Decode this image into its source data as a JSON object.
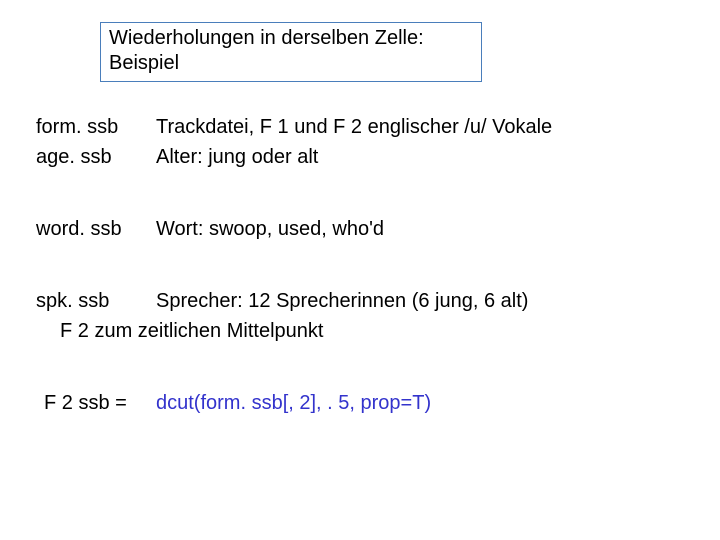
{
  "title": "Wiederholungen in derselben Zelle: Beispiel",
  "rows": [
    {
      "term": "form. ssb",
      "desc": "Trackdatei, F 1 und F 2 englischer /u/ Vokale"
    },
    {
      "term": "age. ssb",
      "desc": "Alter: jung oder alt"
    },
    {
      "term": "word. ssb",
      "desc": "Wort: swoop, used, who'd"
    },
    {
      "term": "spk. ssb",
      "desc": "Sprecher: 12 Sprecherinnen (6 jung, 6 alt)"
    }
  ],
  "note": "F 2 zum zeitlichen Mittelpunkt",
  "code": {
    "lhs": "F 2 ssb =",
    "rhs": "dcut(form. ssb[, 2], . 5, prop=T)"
  }
}
